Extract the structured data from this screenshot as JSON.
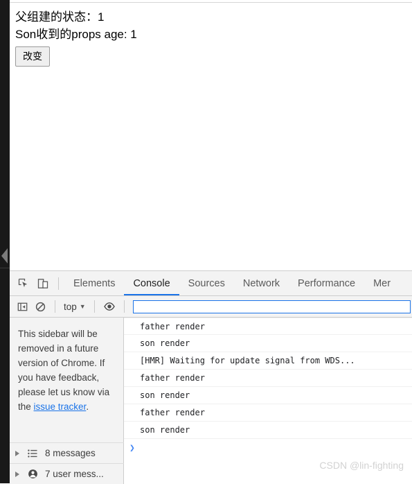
{
  "page": {
    "lines": [
      "父组建的状态：1",
      "Son收到的props age: 1"
    ],
    "button_label": "改变"
  },
  "devtools": {
    "toolbar_icons": [
      {
        "name": "inspect-element-icon",
        "title": "Inspect element"
      },
      {
        "name": "device-toolbar-icon",
        "title": "Toggle device toolbar"
      }
    ],
    "tabs": [
      {
        "label": "Elements",
        "active": false
      },
      {
        "label": "Console",
        "active": true
      },
      {
        "label": "Sources",
        "active": false
      },
      {
        "label": "Network",
        "active": false
      },
      {
        "label": "Performance",
        "active": false
      },
      {
        "label": "Mer",
        "active": false
      }
    ],
    "active_tab_underline_color": "#1a73e8",
    "filterbar": {
      "sidebar_toggle_icon": "console-sidebar-toggle-icon",
      "clear_console_icon": "clear-console-icon",
      "context_label": "top",
      "context_caret": "▼",
      "eye_icon": "live-expression-eye-icon",
      "filter_value": "",
      "filter_placeholder": ""
    },
    "sidebar": {
      "notice_prefix": "This sidebar will be removed in a future version of Chrome. If you have feedback, please let us know via the ",
      "notice_link": "issue tracker",
      "notice_suffix": ".",
      "groups": [
        {
          "icon": "list-icon",
          "label": "8 messages"
        },
        {
          "icon": "user-icon",
          "label": "7 user mess..."
        }
      ]
    },
    "messages": [
      "father render",
      "son render",
      "[HMR] Waiting for update signal from WDS...",
      "father render",
      "son render",
      "father render",
      "son render"
    ],
    "prompt_glyph": "❯"
  },
  "watermark": "CSDN @lin-fighting"
}
